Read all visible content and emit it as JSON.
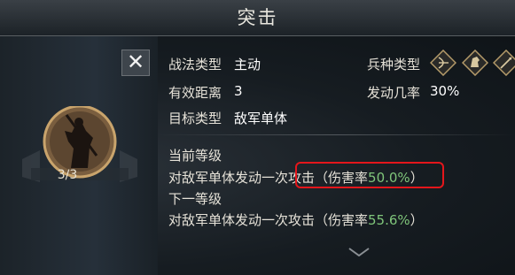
{
  "title": "突击",
  "close_label": "✕",
  "skill": {
    "level_progress": "3/3"
  },
  "info": {
    "tactic_type_label": "战法类型",
    "tactic_type_value": "主动",
    "range_label": "有效距离",
    "range_value": "3",
    "target_label": "目标类型",
    "target_value": "敌军单体",
    "unit_type_label": "兵种类型",
    "trigger_rate_label": "发动几率",
    "trigger_rate_value": "30%"
  },
  "levels": {
    "current_label": "当前等级",
    "current_desc_prefix": "对敌军单体发动一次",
    "current_desc_highlight": "攻击（伤害率",
    "current_rate": "50.0%",
    "current_close": "）",
    "next_label": "下一等级",
    "next_desc": "对敌军单体发动一次攻击（伤害率",
    "next_rate": "55.6%",
    "next_close": "）"
  },
  "unit_icons": [
    "bow-unit-icon",
    "cavalry-unit-icon",
    "spear-unit-icon"
  ],
  "colors": {
    "accent_green": "#7fc57a",
    "highlight_red": "#e4161b"
  }
}
